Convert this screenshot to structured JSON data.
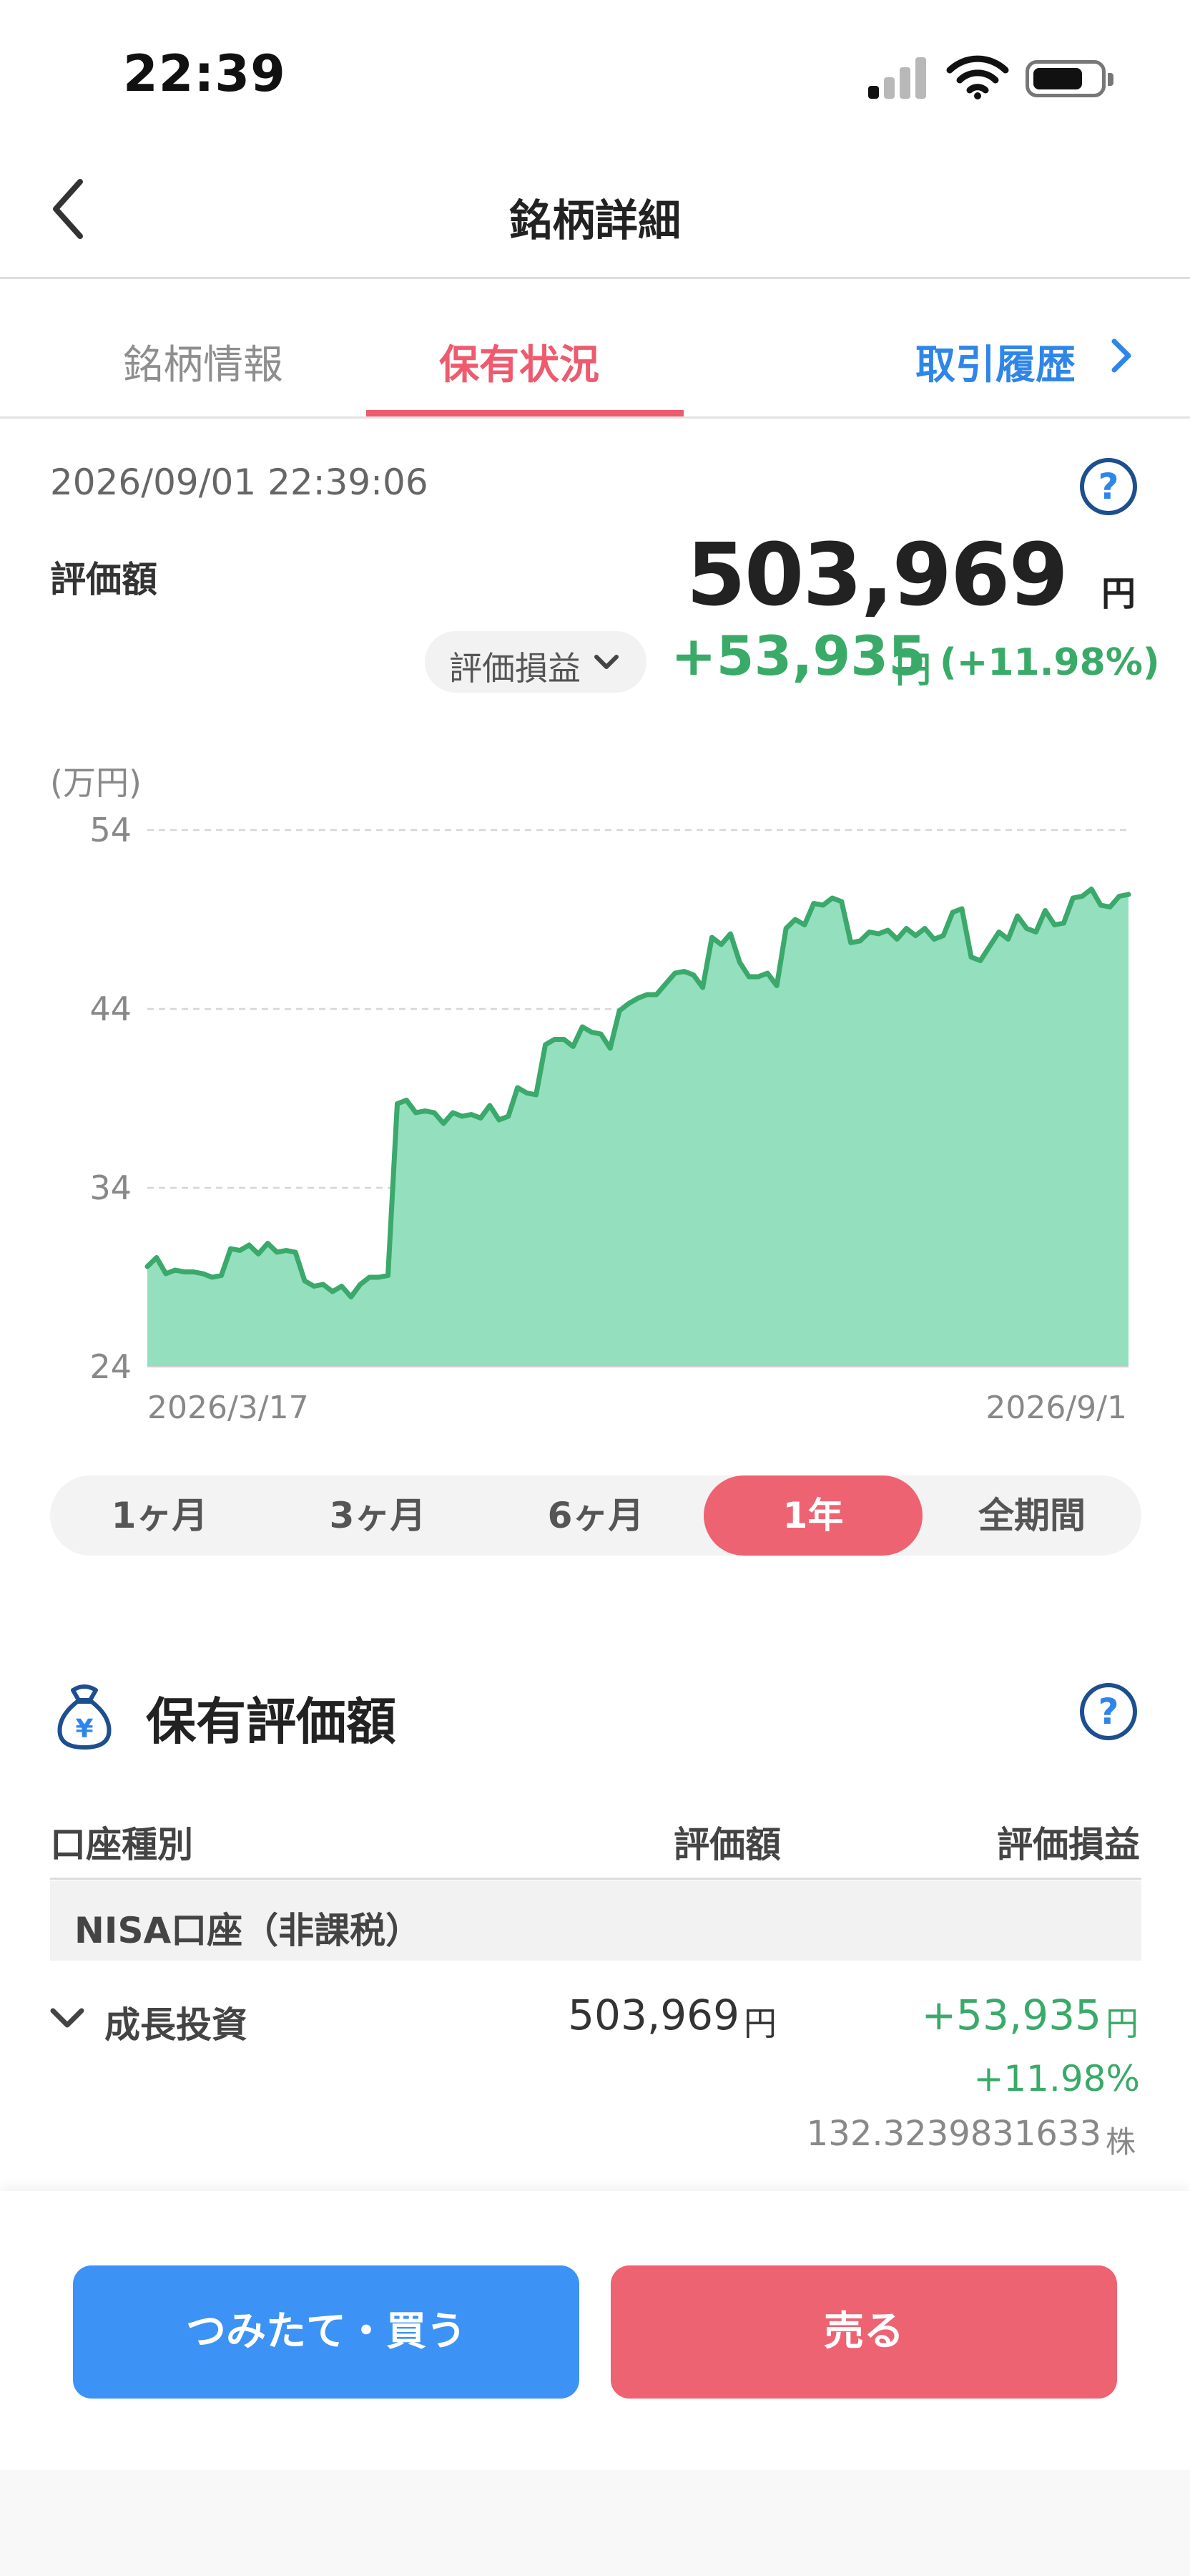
{
  "status_bar": {
    "time": "22:39"
  },
  "header": {
    "title": "銘柄詳細"
  },
  "tabs": [
    {
      "label": "銘柄情報"
    },
    {
      "label": "保有状況"
    },
    {
      "label": "取引履歴"
    }
  ],
  "summary": {
    "timestamp": "2026/09/01 22:39:06",
    "valuation_label": "評価額",
    "valuation_value": "503,969",
    "valuation_unit": "円",
    "pl_selector": "評価損益",
    "pl_amount": "+53,935",
    "pl_unit": "円",
    "pl_percent": "(+11.98%)",
    "help": "?"
  },
  "chart_data": {
    "type": "area",
    "unit_label": "(万円)",
    "ylim": [
      24,
      54
    ],
    "yticks": [
      "54",
      "44",
      "34",
      "24"
    ],
    "x_start_label": "2026/3/17",
    "x_end_label": "2026/9/1",
    "grid": true,
    "line_color": "#3aa96b",
    "fill_color": "#93dfbe",
    "values": [
      29.6,
      30.1,
      29.2,
      29.4,
      29.3,
      29.3,
      29.2,
      29.0,
      29.1,
      30.6,
      30.5,
      30.8,
      30.3,
      30.9,
      30.4,
      30.5,
      30.4,
      28.8,
      28.5,
      28.6,
      28.2,
      28.5,
      27.9,
      28.6,
      29.0,
      29.0,
      29.1,
      38.7,
      38.9,
      38.2,
      38.3,
      38.2,
      37.6,
      38.2,
      38.0,
      38.1,
      37.9,
      38.6,
      37.8,
      38.0,
      39.6,
      39.3,
      39.2,
      42.0,
      42.3,
      42.3,
      41.9,
      43.0,
      42.7,
      42.6,
      41.8,
      43.9,
      44.3,
      44.6,
      44.8,
      44.8,
      45.4,
      46.0,
      46.1,
      45.9,
      45.2,
      48.0,
      47.6,
      48.2,
      46.6,
      45.8,
      45.8,
      46.0,
      45.3,
      48.5,
      49.0,
      48.7,
      49.9,
      49.8,
      50.2,
      50.0,
      47.7,
      47.8,
      48.3,
      48.2,
      48.4,
      47.9,
      48.5,
      48.1,
      48.5,
      47.9,
      48.1,
      49.4,
      49.6,
      46.9,
      46.7,
      47.5,
      48.3,
      47.9,
      49.2,
      48.5,
      48.3,
      49.5,
      48.7,
      48.8,
      50.2,
      50.3,
      50.7,
      49.8,
      49.7,
      50.3,
      50.4
    ]
  },
  "periods": [
    {
      "label": "1ヶ月",
      "active": false
    },
    {
      "label": "3ヶ月",
      "active": false
    },
    {
      "label": "6ヶ月",
      "active": false
    },
    {
      "label": "1年",
      "active": true
    },
    {
      "label": "全期間",
      "active": false
    }
  ],
  "holdings": {
    "title": "保有評価額",
    "columns": {
      "type": "口座種別",
      "valuation": "評価額",
      "pl": "評価損益"
    },
    "account_label": "NISA口座（非課税）",
    "row": {
      "name": "成長投資",
      "valuation": "503,969",
      "valuation_unit": "円",
      "pl": "+53,935",
      "pl_unit": "円",
      "pl_percent": "+11.98%",
      "shares": "132.3239831633",
      "shares_unit": "株"
    }
  },
  "actions": {
    "buy": "つみたて・買う",
    "sell": "売る"
  },
  "colors": {
    "accent_pink": "#ee6372",
    "accent_blue": "#3d92f5",
    "gain_green": "#3aaa68",
    "link_blue": "#2f86e8"
  }
}
